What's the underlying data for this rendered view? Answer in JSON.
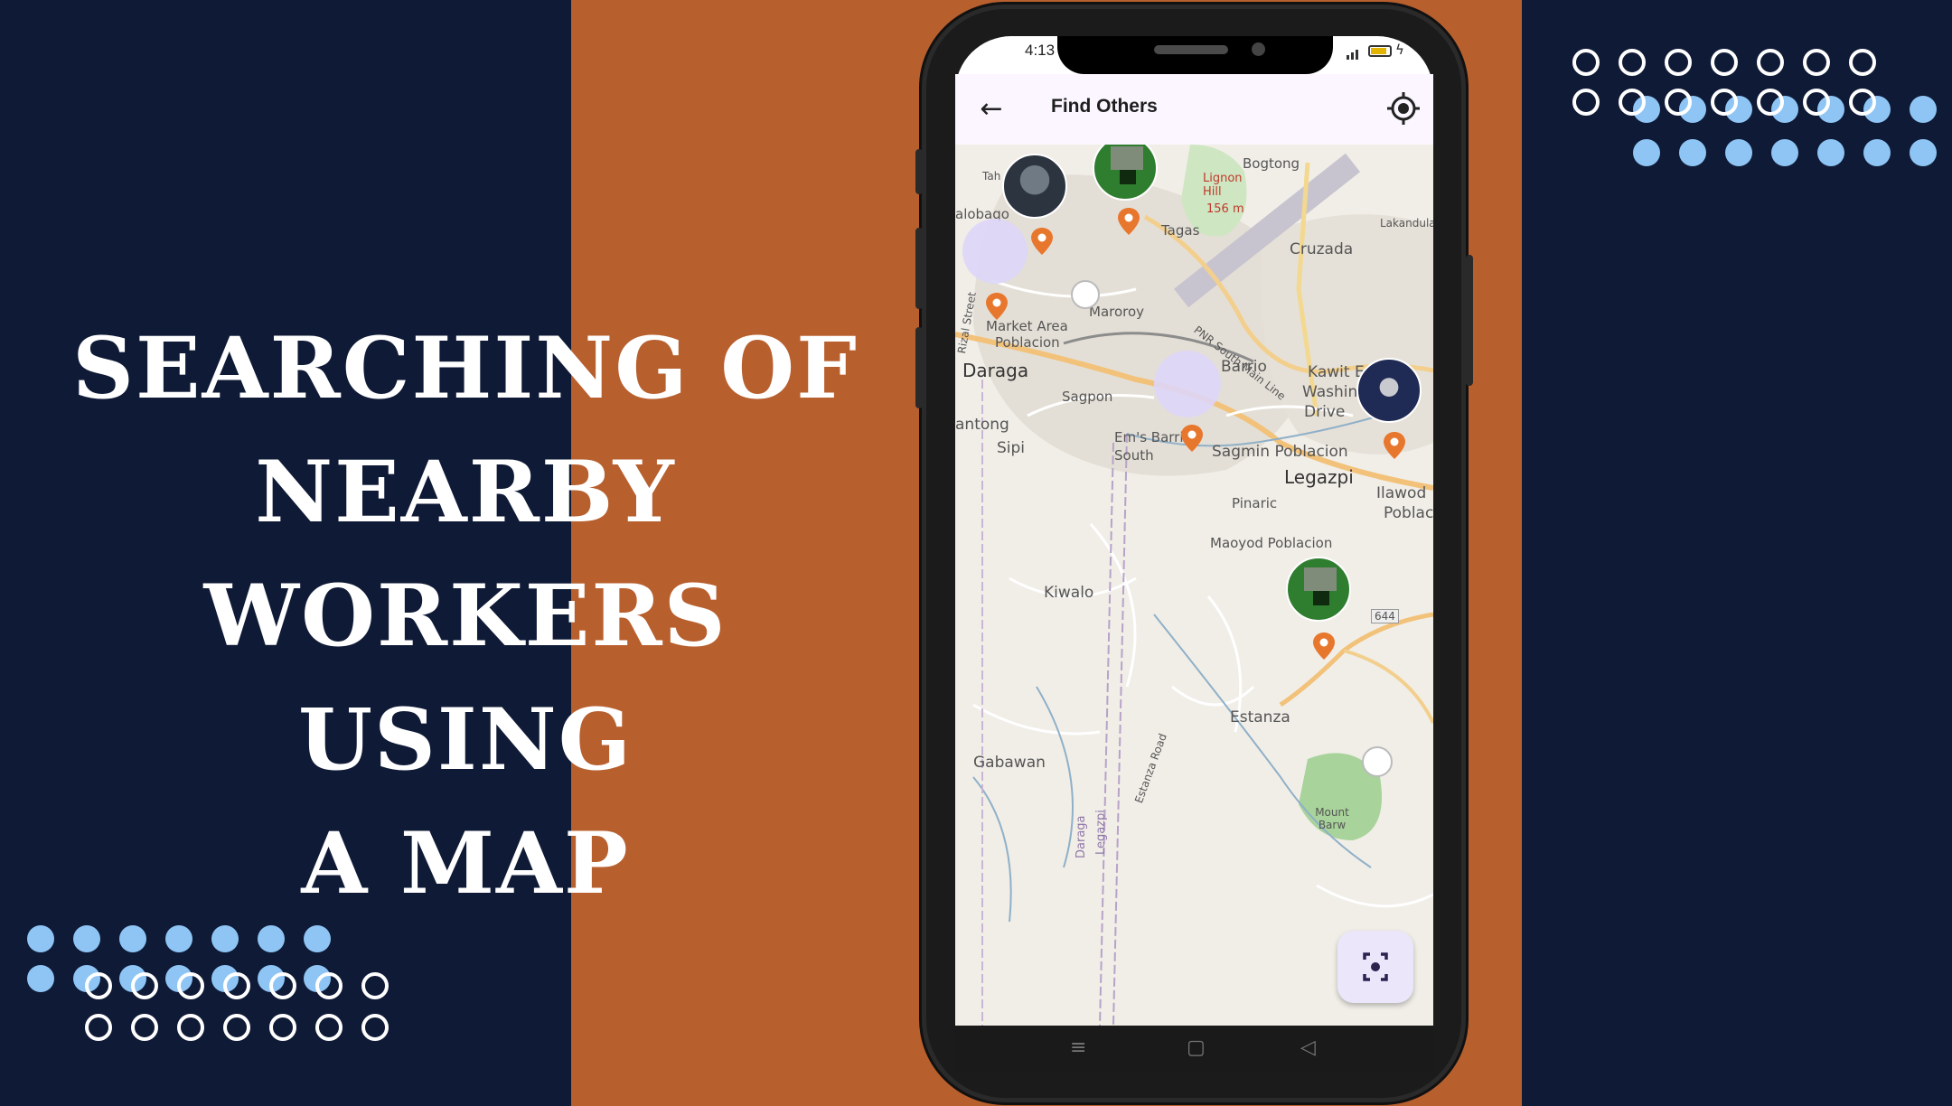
{
  "headline": {
    "line1": "SEARCHING OF",
    "line2": "NEARBY",
    "line3": "WORKERS USING",
    "line4": "A MAP"
  },
  "colors": {
    "navy": "#0f1a36",
    "orange": "#b85f2e",
    "dot_blue": "#8ec5f5",
    "pin_orange": "#e8772e",
    "fab_bg": "#ece6fb"
  },
  "status_bar": {
    "time": "4:13"
  },
  "app_bar": {
    "back_icon": "arrow-left-icon",
    "title": "Find Others",
    "action_icon": "my-location-icon"
  },
  "map": {
    "labels": [
      "Tah",
      "alobaqo",
      "Bogtong",
      "Lignon Hill",
      "156 m",
      "Lakandula",
      "Tagas",
      "Cruzada",
      "Maroroy",
      "Rizal Street",
      "Market Area",
      "Poblacion",
      "Daraga",
      "Barrio",
      "Kawit E",
      "Sagpon",
      "PNR South Main Line",
      "Washin",
      "Drive",
      "antong",
      "Em's Barrio South",
      "Sipi",
      "Sagmin Poblacion",
      "Legazpi",
      "Pinaric",
      "Ilawod",
      "Poblac",
      "Maoyod Poblacion",
      "Kiwalo",
      "644",
      "Estanza",
      "Gabawan",
      "Estanza Road",
      "Daraga",
      "Legazpi",
      "Mount Barw"
    ]
  },
  "fab": {
    "icon": "scan-focus-icon"
  },
  "nav_bar": {
    "menu_icon": "≡",
    "home_icon": "▢",
    "back_icon": "◁"
  }
}
